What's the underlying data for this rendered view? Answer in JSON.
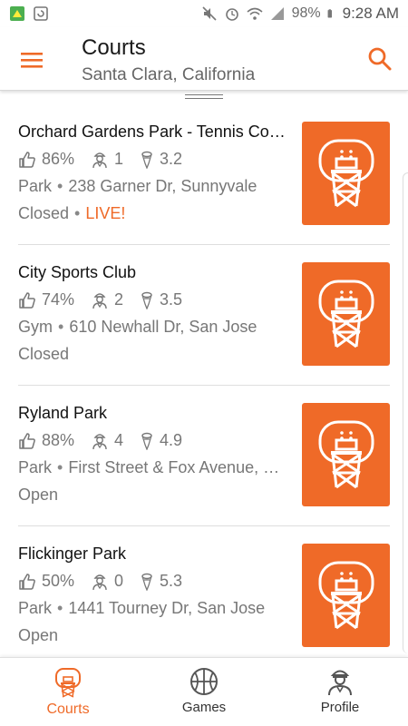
{
  "status_bar": {
    "battery": "98%",
    "time": "9:28 AM"
  },
  "header": {
    "title": "Courts",
    "subtitle": "Santa Clara, California"
  },
  "colors": {
    "accent": "#ef6a28"
  },
  "courts": [
    {
      "name": "Orchard Gardens Park - Tennis Cou…",
      "rating": "86%",
      "players": "1",
      "score": "3.2",
      "type": "Park",
      "address": "238 Garner Dr, Sunnyvale",
      "status": "Closed",
      "live": "LIVE!"
    },
    {
      "name": "City Sports Club",
      "rating": "74%",
      "players": "2",
      "score": "3.5",
      "type": "Gym",
      "address": "610 Newhall Dr, San Jose",
      "status": "Closed",
      "live": ""
    },
    {
      "name": "Ryland Park",
      "rating": "88%",
      "players": "4",
      "score": "4.9",
      "type": "Park",
      "address": "First Street & Fox Avenue, Sa…",
      "status": "Open",
      "live": ""
    },
    {
      "name": "Flickinger Park",
      "rating": "50%",
      "players": "0",
      "score": "5.3",
      "type": "Park",
      "address": "1441 Tourney Dr, San Jose",
      "status": "Open",
      "live": ""
    }
  ],
  "bottom_nav": {
    "items": [
      {
        "label": "Courts",
        "icon": "basketball-hoop-icon",
        "active": true
      },
      {
        "label": "Games",
        "icon": "basketball-icon",
        "active": false
      },
      {
        "label": "Profile",
        "icon": "player-profile-icon",
        "active": false
      }
    ]
  }
}
